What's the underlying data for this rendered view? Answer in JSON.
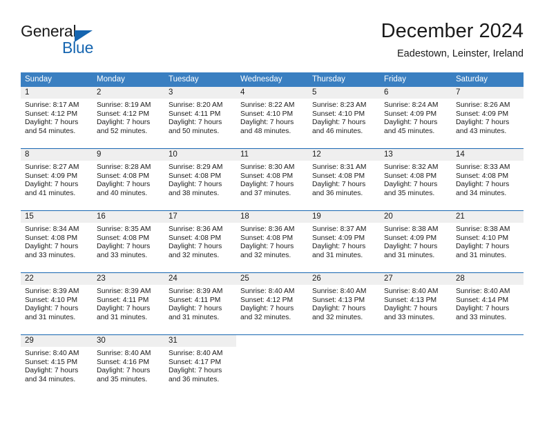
{
  "brand": {
    "name_top": "General",
    "name_bottom": "Blue",
    "accent_color": "#1565b0"
  },
  "header": {
    "title": "December 2024",
    "subtitle": "Eadestown, Leinster, Ireland"
  },
  "calendar": {
    "header_bg": "#3a7fc1",
    "separator_color": "#1565b0",
    "daynum_band_bg": "#efefef",
    "weekdays": [
      "Sunday",
      "Monday",
      "Tuesday",
      "Wednesday",
      "Thursday",
      "Friday",
      "Saturday"
    ],
    "weeks": [
      [
        {
          "day": "1",
          "sunrise": "Sunrise: 8:17 AM",
          "sunset": "Sunset: 4:12 PM",
          "daylight1": "Daylight: 7 hours",
          "daylight2": "and 54 minutes."
        },
        {
          "day": "2",
          "sunrise": "Sunrise: 8:19 AM",
          "sunset": "Sunset: 4:12 PM",
          "daylight1": "Daylight: 7 hours",
          "daylight2": "and 52 minutes."
        },
        {
          "day": "3",
          "sunrise": "Sunrise: 8:20 AM",
          "sunset": "Sunset: 4:11 PM",
          "daylight1": "Daylight: 7 hours",
          "daylight2": "and 50 minutes."
        },
        {
          "day": "4",
          "sunrise": "Sunrise: 8:22 AM",
          "sunset": "Sunset: 4:10 PM",
          "daylight1": "Daylight: 7 hours",
          "daylight2": "and 48 minutes."
        },
        {
          "day": "5",
          "sunrise": "Sunrise: 8:23 AM",
          "sunset": "Sunset: 4:10 PM",
          "daylight1": "Daylight: 7 hours",
          "daylight2": "and 46 minutes."
        },
        {
          "day": "6",
          "sunrise": "Sunrise: 8:24 AM",
          "sunset": "Sunset: 4:09 PM",
          "daylight1": "Daylight: 7 hours",
          "daylight2": "and 45 minutes."
        },
        {
          "day": "7",
          "sunrise": "Sunrise: 8:26 AM",
          "sunset": "Sunset: 4:09 PM",
          "daylight1": "Daylight: 7 hours",
          "daylight2": "and 43 minutes."
        }
      ],
      [
        {
          "day": "8",
          "sunrise": "Sunrise: 8:27 AM",
          "sunset": "Sunset: 4:09 PM",
          "daylight1": "Daylight: 7 hours",
          "daylight2": "and 41 minutes."
        },
        {
          "day": "9",
          "sunrise": "Sunrise: 8:28 AM",
          "sunset": "Sunset: 4:08 PM",
          "daylight1": "Daylight: 7 hours",
          "daylight2": "and 40 minutes."
        },
        {
          "day": "10",
          "sunrise": "Sunrise: 8:29 AM",
          "sunset": "Sunset: 4:08 PM",
          "daylight1": "Daylight: 7 hours",
          "daylight2": "and 38 minutes."
        },
        {
          "day": "11",
          "sunrise": "Sunrise: 8:30 AM",
          "sunset": "Sunset: 4:08 PM",
          "daylight1": "Daylight: 7 hours",
          "daylight2": "and 37 minutes."
        },
        {
          "day": "12",
          "sunrise": "Sunrise: 8:31 AM",
          "sunset": "Sunset: 4:08 PM",
          "daylight1": "Daylight: 7 hours",
          "daylight2": "and 36 minutes."
        },
        {
          "day": "13",
          "sunrise": "Sunrise: 8:32 AM",
          "sunset": "Sunset: 4:08 PM",
          "daylight1": "Daylight: 7 hours",
          "daylight2": "and 35 minutes."
        },
        {
          "day": "14",
          "sunrise": "Sunrise: 8:33 AM",
          "sunset": "Sunset: 4:08 PM",
          "daylight1": "Daylight: 7 hours",
          "daylight2": "and 34 minutes."
        }
      ],
      [
        {
          "day": "15",
          "sunrise": "Sunrise: 8:34 AM",
          "sunset": "Sunset: 4:08 PM",
          "daylight1": "Daylight: 7 hours",
          "daylight2": "and 33 minutes."
        },
        {
          "day": "16",
          "sunrise": "Sunrise: 8:35 AM",
          "sunset": "Sunset: 4:08 PM",
          "daylight1": "Daylight: 7 hours",
          "daylight2": "and 33 minutes."
        },
        {
          "day": "17",
          "sunrise": "Sunrise: 8:36 AM",
          "sunset": "Sunset: 4:08 PM",
          "daylight1": "Daylight: 7 hours",
          "daylight2": "and 32 minutes."
        },
        {
          "day": "18",
          "sunrise": "Sunrise: 8:36 AM",
          "sunset": "Sunset: 4:08 PM",
          "daylight1": "Daylight: 7 hours",
          "daylight2": "and 32 minutes."
        },
        {
          "day": "19",
          "sunrise": "Sunrise: 8:37 AM",
          "sunset": "Sunset: 4:09 PM",
          "daylight1": "Daylight: 7 hours",
          "daylight2": "and 31 minutes."
        },
        {
          "day": "20",
          "sunrise": "Sunrise: 8:38 AM",
          "sunset": "Sunset: 4:09 PM",
          "daylight1": "Daylight: 7 hours",
          "daylight2": "and 31 minutes."
        },
        {
          "day": "21",
          "sunrise": "Sunrise: 8:38 AM",
          "sunset": "Sunset: 4:10 PM",
          "daylight1": "Daylight: 7 hours",
          "daylight2": "and 31 minutes."
        }
      ],
      [
        {
          "day": "22",
          "sunrise": "Sunrise: 8:39 AM",
          "sunset": "Sunset: 4:10 PM",
          "daylight1": "Daylight: 7 hours",
          "daylight2": "and 31 minutes."
        },
        {
          "day": "23",
          "sunrise": "Sunrise: 8:39 AM",
          "sunset": "Sunset: 4:11 PM",
          "daylight1": "Daylight: 7 hours",
          "daylight2": "and 31 minutes."
        },
        {
          "day": "24",
          "sunrise": "Sunrise: 8:39 AM",
          "sunset": "Sunset: 4:11 PM",
          "daylight1": "Daylight: 7 hours",
          "daylight2": "and 31 minutes."
        },
        {
          "day": "25",
          "sunrise": "Sunrise: 8:40 AM",
          "sunset": "Sunset: 4:12 PM",
          "daylight1": "Daylight: 7 hours",
          "daylight2": "and 32 minutes."
        },
        {
          "day": "26",
          "sunrise": "Sunrise: 8:40 AM",
          "sunset": "Sunset: 4:13 PM",
          "daylight1": "Daylight: 7 hours",
          "daylight2": "and 32 minutes."
        },
        {
          "day": "27",
          "sunrise": "Sunrise: 8:40 AM",
          "sunset": "Sunset: 4:13 PM",
          "daylight1": "Daylight: 7 hours",
          "daylight2": "and 33 minutes."
        },
        {
          "day": "28",
          "sunrise": "Sunrise: 8:40 AM",
          "sunset": "Sunset: 4:14 PM",
          "daylight1": "Daylight: 7 hours",
          "daylight2": "and 33 minutes."
        }
      ],
      [
        {
          "day": "29",
          "sunrise": "Sunrise: 8:40 AM",
          "sunset": "Sunset: 4:15 PM",
          "daylight1": "Daylight: 7 hours",
          "daylight2": "and 34 minutes."
        },
        {
          "day": "30",
          "sunrise": "Sunrise: 8:40 AM",
          "sunset": "Sunset: 4:16 PM",
          "daylight1": "Daylight: 7 hours",
          "daylight2": "and 35 minutes."
        },
        {
          "day": "31",
          "sunrise": "Sunrise: 8:40 AM",
          "sunset": "Sunset: 4:17 PM",
          "daylight1": "Daylight: 7 hours",
          "daylight2": "and 36 minutes."
        },
        {
          "day": "",
          "sunrise": "",
          "sunset": "",
          "daylight1": "",
          "daylight2": ""
        },
        {
          "day": "",
          "sunrise": "",
          "sunset": "",
          "daylight1": "",
          "daylight2": ""
        },
        {
          "day": "",
          "sunrise": "",
          "sunset": "",
          "daylight1": "",
          "daylight2": ""
        },
        {
          "day": "",
          "sunrise": "",
          "sunset": "",
          "daylight1": "",
          "daylight2": ""
        }
      ]
    ]
  }
}
